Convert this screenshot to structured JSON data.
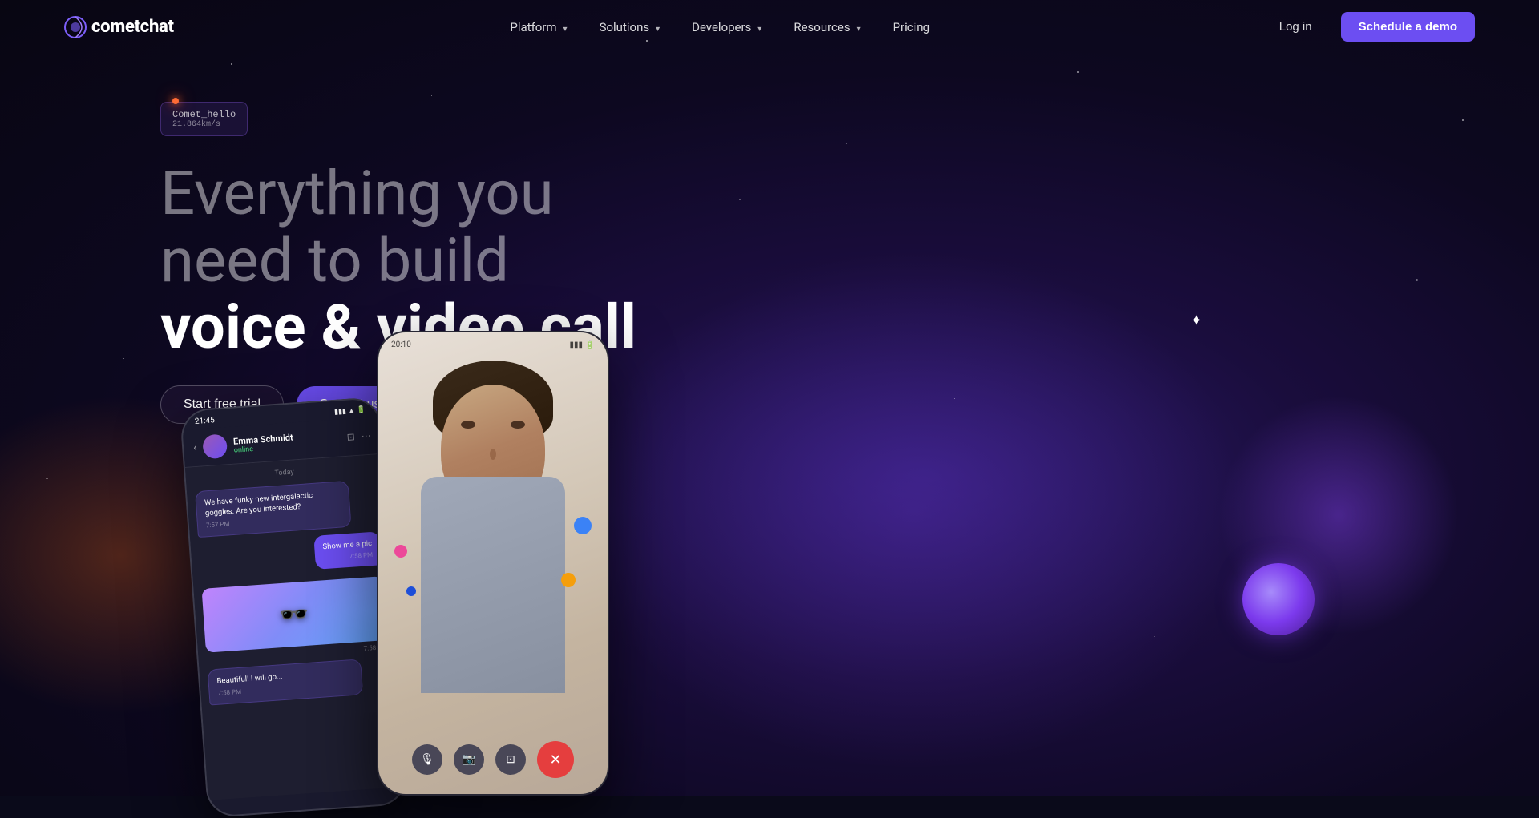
{
  "logo": {
    "text_comet": "comet",
    "text_chat": "chat"
  },
  "nav": {
    "links": [
      {
        "label": "Platform",
        "has_chevron": true
      },
      {
        "label": "Solutions",
        "has_chevron": true
      },
      {
        "label": "Developers",
        "has_chevron": true
      },
      {
        "label": "Resources",
        "has_chevron": true
      },
      {
        "label": "Pricing",
        "has_chevron": false
      }
    ],
    "login_label": "Log in",
    "demo_label": "Schedule a demo"
  },
  "hero": {
    "badge_line1": "Comet_hello",
    "badge_line2": "21.864km/s",
    "title_dim1": "Everything you",
    "title_dim2": "need to build",
    "title_bright": "voice & video call",
    "btn_trial": "Start free trial",
    "btn_contact": "Contact us"
  },
  "chat_phone": {
    "time": "21:45",
    "contact_name": "Emma Schmidt",
    "contact_status": "online",
    "date_label": "Today",
    "messages": [
      {
        "type": "received",
        "text": "We have funky new intergalactic goggles. Are you interested?",
        "time": "7:57 PM"
      },
      {
        "type": "sent",
        "text": "Show me a pic",
        "time": "7:58 PM",
        "has_image": true
      },
      {
        "type": "received",
        "text": "Beautiful! I will go...",
        "time": "7:58 PM"
      }
    ]
  },
  "video_phone": {
    "time": "20:10",
    "controls": [
      {
        "icon": "🎤",
        "type": "mute",
        "label": "mute"
      },
      {
        "icon": "📹",
        "type": "camera",
        "label": "camera"
      },
      {
        "icon": "💻",
        "type": "screen",
        "label": "screen-share"
      },
      {
        "icon": "✕",
        "type": "end",
        "label": "end-call"
      }
    ]
  },
  "colors": {
    "bg_dark": "#0a0a1a",
    "purple_accent": "#6c4ef2",
    "nav_bg": "transparent"
  }
}
